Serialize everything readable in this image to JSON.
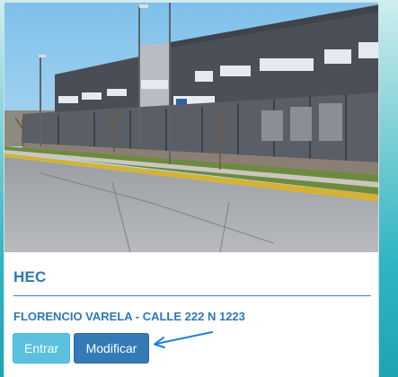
{
  "card": {
    "title": "HEC",
    "address": "FLORENCIO VARELA - CALLE 222 N 1223",
    "image": {
      "name": "school-building-photo"
    },
    "buttons": {
      "enter_label": "Entrar",
      "modify_label": "Modificar"
    }
  },
  "colors": {
    "accent": "#2e78b4",
    "enter_button": "#5bc0de",
    "modify_button": "#337ab7",
    "annotation_arrow": "#1e7fe0"
  }
}
